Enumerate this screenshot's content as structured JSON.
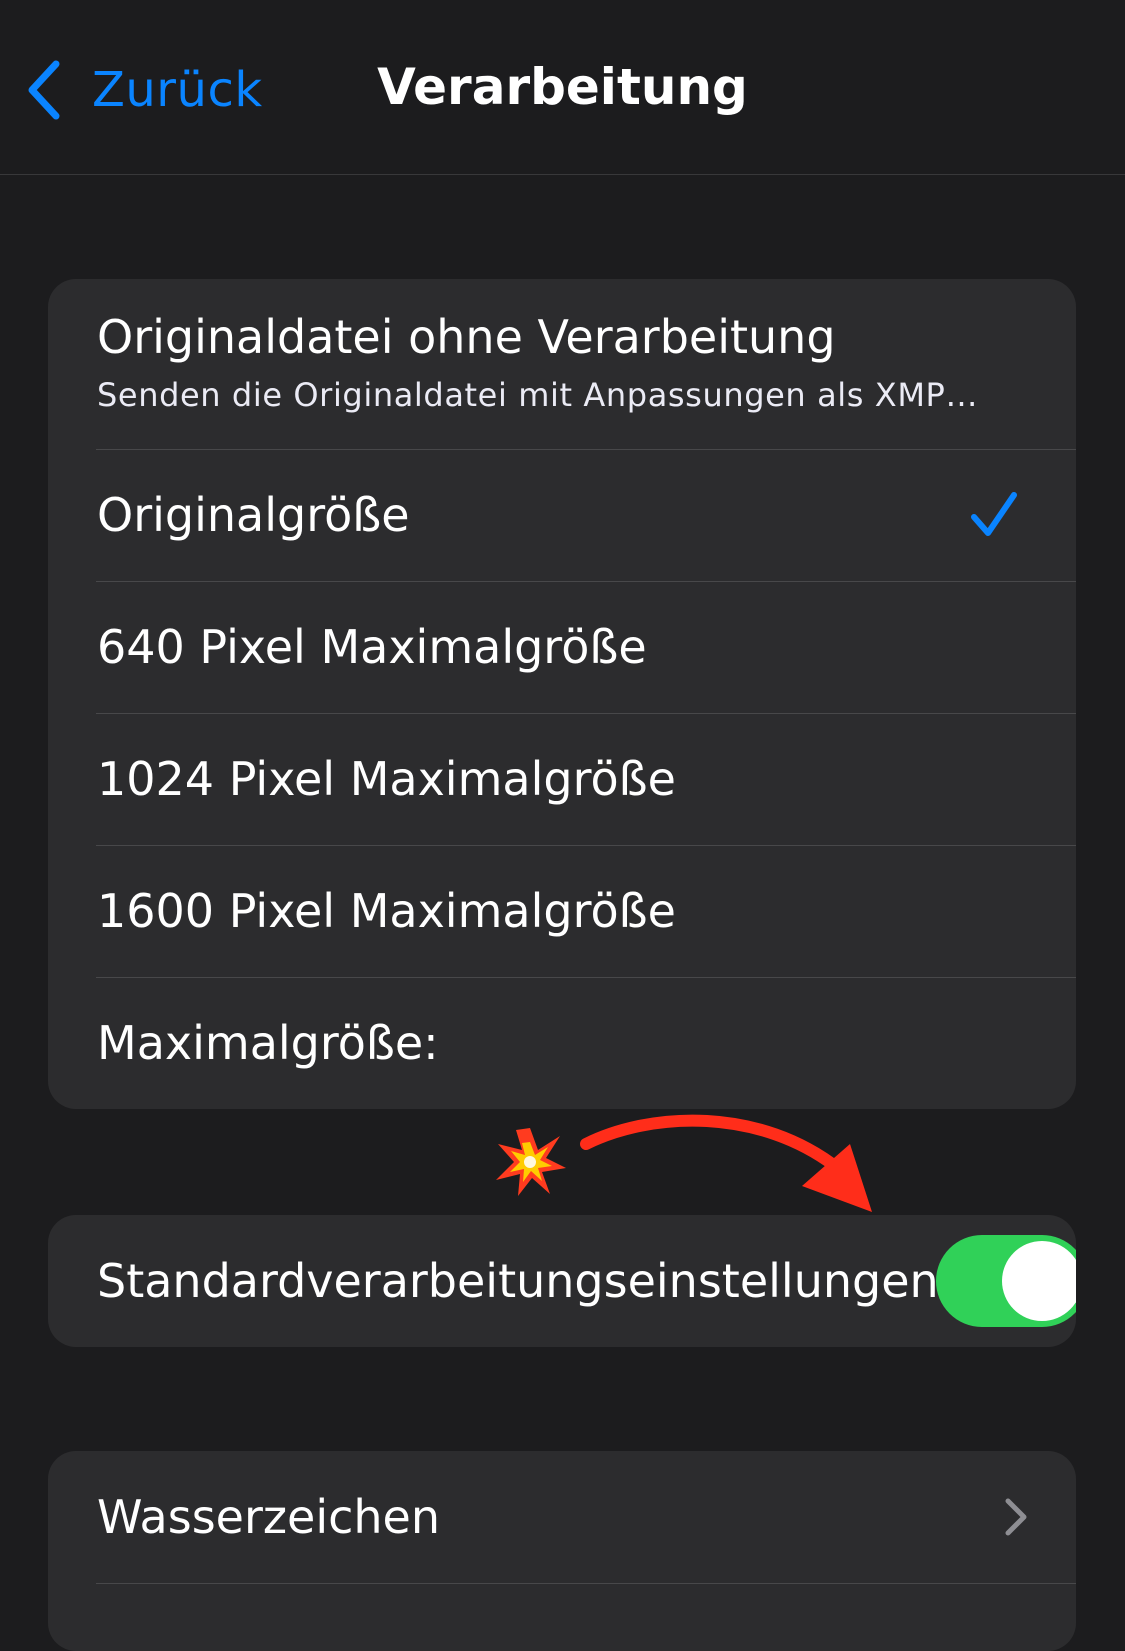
{
  "navbar": {
    "back_label": "Zurück",
    "title": "Verarbeitung"
  },
  "size_group": {
    "original_row": {
      "label": "Originaldatei ohne Verarbeitung",
      "sublabel": "Senden die Originaldatei mit Anpassungen als XMP…"
    },
    "options": [
      {
        "label": "Originalgröße",
        "selected": true
      },
      {
        "label": "640 Pixel Maximalgröße",
        "selected": false
      },
      {
        "label": "1024 Pixel Maximalgröße",
        "selected": false
      },
      {
        "label": "1600 Pixel Maximalgröße",
        "selected": false
      },
      {
        "label": "Maximalgröße:",
        "selected": false
      }
    ]
  },
  "default_group": {
    "label": "Standardverarbeitungseinstellungen",
    "toggle_on": true
  },
  "watermark_group": {
    "label": "Wasserzeichen"
  },
  "colors": {
    "accent": "#0a84ff",
    "toggle_on": "#30d158",
    "background": "#1c1c1e",
    "group_background": "#2c2c2e",
    "annotation_arrow": "#ff2d1a"
  },
  "icons": [
    "chevron-left-icon",
    "checkmark-icon",
    "collision-emoji-icon",
    "chevron-right-icon"
  ]
}
